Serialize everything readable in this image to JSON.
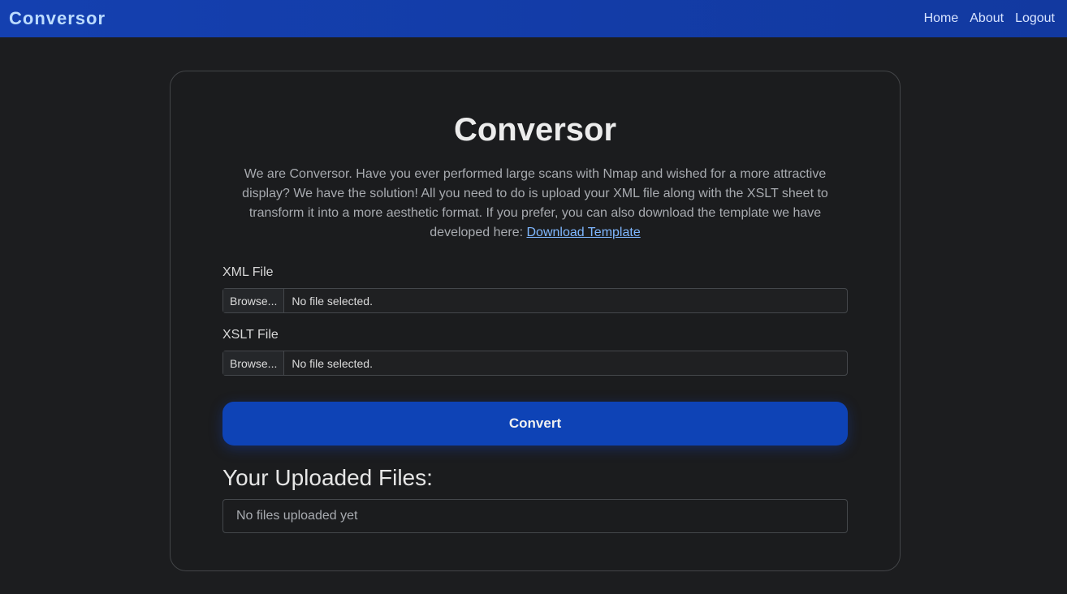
{
  "nav": {
    "brand": "Conversor",
    "links": [
      "Home",
      "About",
      "Logout"
    ]
  },
  "main": {
    "title": "Conversor",
    "description": "We are Conversor. Have you ever performed large scans with Nmap and wished for a more attractive display? We have the solution! All you need to do is upload your XML file along with the XSLT sheet to transform it into a more aesthetic format. If you prefer, you can also download the template we have developed here: ",
    "download_link": "Download Template",
    "xml_label": "XML File",
    "xslt_label": "XSLT File",
    "browse": "Browse...",
    "no_file": "No file selected.",
    "convert": "Convert",
    "uploaded_title": "Your Uploaded Files:",
    "no_uploads": "No files uploaded yet"
  }
}
